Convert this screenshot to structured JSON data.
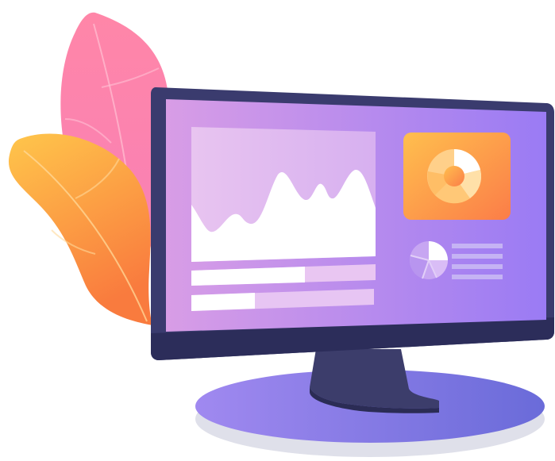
{
  "illustration": {
    "subject": "desktop-monitor-dashboard",
    "colors": {
      "leaf_pink": "#fb8db0",
      "leaf_orange": "#fdb04a",
      "bezel": "#3a3b6e",
      "screen_left": "#d79be6",
      "screen_right": "#9b7af2",
      "panel_light": "#e7c2ef",
      "tile_orange": "#fda453",
      "base_top": "#8c7ae8",
      "base_shadow": "#dfe0ea",
      "stand": "#3c3d6b"
    },
    "dashboard": {
      "progress_bars": [
        0.63,
        0.35
      ],
      "mini_pie_highlight": 0.2,
      "text_lines": 4
    }
  }
}
